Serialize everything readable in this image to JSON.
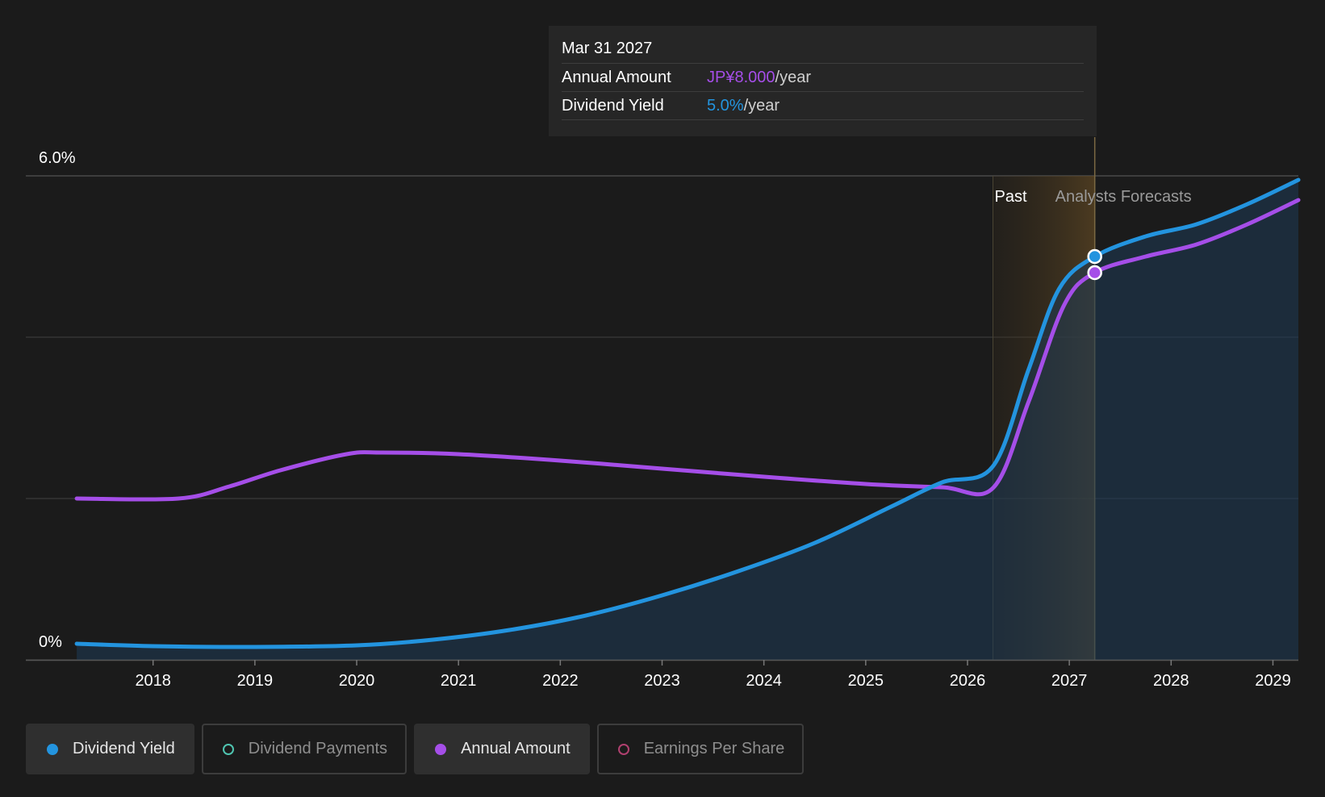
{
  "tooltip": {
    "date": "Mar 31 2027",
    "rows": [
      {
        "label": "Annual Amount",
        "value": "JP¥8.000",
        "unit": "/year"
      },
      {
        "label": "Dividend Yield",
        "value": "5.0%",
        "unit": "/year"
      }
    ]
  },
  "legend": [
    {
      "label": "Dividend Yield",
      "color": "#2394df",
      "active": true,
      "filled": true
    },
    {
      "label": "Dividend Payments",
      "color": "#4fc4b0",
      "active": false,
      "filled": false
    },
    {
      "label": "Annual Amount",
      "color": "#a54ee8",
      "active": true,
      "filled": true
    },
    {
      "label": "Earnings Per Share",
      "color": "#b0406f",
      "active": false,
      "filled": false
    }
  ],
  "chart_data": {
    "type": "line",
    "ylim": [
      0,
      6
    ],
    "y_ticks": [
      {
        "value": 6,
        "label": "6.0%"
      },
      {
        "value": 0,
        "label": "0%"
      }
    ],
    "gridlines": [
      0,
      2,
      4,
      6
    ],
    "xlim": [
      2016.75,
      2029.25
    ],
    "x_ticks": [
      "2018",
      "2019",
      "2020",
      "2021",
      "2022",
      "2023",
      "2024",
      "2025",
      "2026",
      "2027",
      "2028",
      "2029"
    ],
    "regions": {
      "past_label": "Past",
      "forecast_label": "Analysts Forecasts",
      "past_end": 2026.25,
      "cursor": 2027.25
    },
    "series": [
      {
        "name": "Dividend Yield",
        "color": "#2394df",
        "points": [
          [
            2017.25,
            0.2
          ],
          [
            2018.0,
            0.17
          ],
          [
            2019.0,
            0.16
          ],
          [
            2020.0,
            0.18
          ],
          [
            2020.75,
            0.25
          ],
          [
            2021.5,
            0.37
          ],
          [
            2022.25,
            0.55
          ],
          [
            2023.0,
            0.8
          ],
          [
            2023.75,
            1.1
          ],
          [
            2024.5,
            1.45
          ],
          [
            2025.25,
            1.9
          ],
          [
            2025.75,
            2.2
          ],
          [
            2026.25,
            2.4
          ],
          [
            2026.6,
            3.6
          ],
          [
            2026.9,
            4.6
          ],
          [
            2027.25,
            5.0
          ],
          [
            2027.75,
            5.25
          ],
          [
            2028.25,
            5.4
          ],
          [
            2028.75,
            5.65
          ],
          [
            2029.25,
            5.95
          ]
        ]
      },
      {
        "name": "Annual Amount",
        "color": "#a54ee8",
        "points": [
          [
            2017.25,
            2.0
          ],
          [
            2018.25,
            2.0
          ],
          [
            2018.75,
            2.15
          ],
          [
            2019.25,
            2.35
          ],
          [
            2019.9,
            2.55
          ],
          [
            2020.25,
            2.57
          ],
          [
            2021.0,
            2.55
          ],
          [
            2022.0,
            2.47
          ],
          [
            2023.0,
            2.37
          ],
          [
            2024.0,
            2.27
          ],
          [
            2025.0,
            2.18
          ],
          [
            2025.75,
            2.14
          ],
          [
            2026.25,
            2.13
          ],
          [
            2026.6,
            3.2
          ],
          [
            2026.95,
            4.4
          ],
          [
            2027.25,
            4.8
          ],
          [
            2027.75,
            5.0
          ],
          [
            2028.25,
            5.15
          ],
          [
            2028.75,
            5.4
          ],
          [
            2029.25,
            5.7
          ]
        ]
      }
    ]
  }
}
